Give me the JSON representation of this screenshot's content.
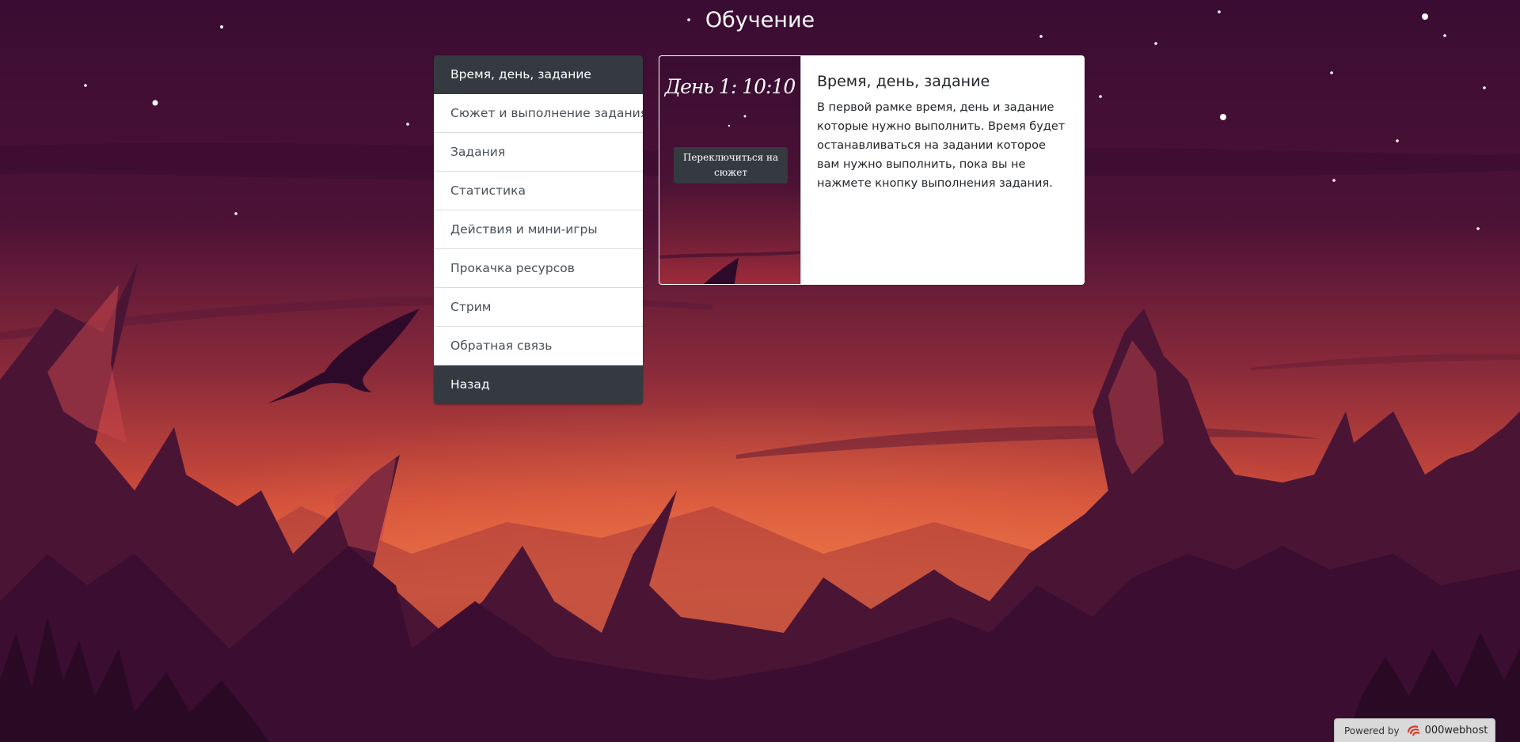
{
  "page": {
    "title": "Обучение"
  },
  "menu": {
    "items": [
      {
        "label": "Время, день, задание",
        "active": true
      },
      {
        "label": "Сюжет и выполнение задания"
      },
      {
        "label": "Задания"
      },
      {
        "label": "Статистика"
      },
      {
        "label": "Действия и мини-игры"
      },
      {
        "label": "Прокачка ресурсов"
      },
      {
        "label": "Стрим"
      },
      {
        "label": "Обратная связь"
      }
    ],
    "back_label": "Назад"
  },
  "card": {
    "preview_time": "День 1: 10:10",
    "preview_button": "Переключиться на сюжет",
    "title": "Время, день, задание",
    "text": "В первой рамке время, день и задание которые нужно выполнить. Время будет останавливаться на задании которое вам нужно выполнить, пока вы не нажмете кнопку выполнения задания."
  },
  "footer": {
    "powered_by": "Powered by",
    "brand": "000webhost"
  },
  "colors": {
    "menu_active_bg": "#343a40",
    "sky_top": "#3a0d33",
    "horizon": "#e0563b"
  }
}
